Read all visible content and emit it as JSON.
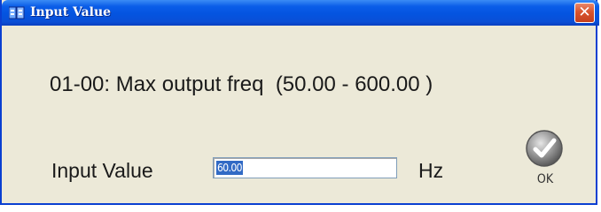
{
  "window": {
    "title": "Input Value",
    "close_glyph": "✕"
  },
  "parameter": {
    "label": "01-00: Max output freq  (50.00 - 600.00 )"
  },
  "input": {
    "label": "Input Value",
    "value": "60.00",
    "unit": "Hz"
  },
  "ok_button": {
    "label": "OK",
    "icon": "checkmark-icon"
  },
  "colors": {
    "titlebar": "#0454e0",
    "close_button": "#d9542d",
    "dialog_bg": "#ece9d8",
    "selection": "#316ac5"
  }
}
